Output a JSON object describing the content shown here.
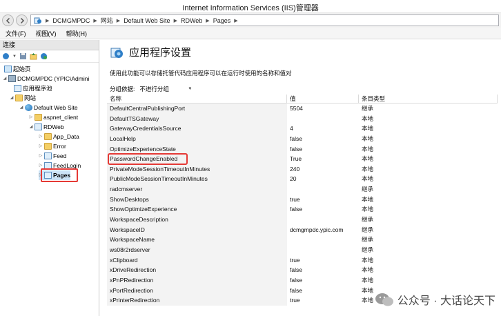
{
  "window": {
    "title": "Internet Information Services (IIS)管理器"
  },
  "address": {
    "segments": [
      "DCMGMPDC",
      "网站",
      "Default Web Site",
      "RDWeb",
      "Pages"
    ]
  },
  "menu": {
    "items": [
      "文件(F)",
      "视图(V)",
      "帮助(H)"
    ]
  },
  "connections": {
    "title": "连接",
    "tree": [
      {
        "label": "起始页",
        "icon": "start-page-icon"
      },
      {
        "label": "DCMGMPDC (YPIC\\Admini",
        "icon": "server-icon"
      },
      {
        "label": "应用程序池",
        "icon": "app-pool-icon"
      },
      {
        "label": "网站",
        "icon": "sites-folder-icon"
      },
      {
        "label": "Default Web Site",
        "icon": "globe-icon"
      },
      {
        "label": "aspnet_client",
        "icon": "folder-icon"
      },
      {
        "label": "RDWeb",
        "icon": "application-icon"
      },
      {
        "label": "App_Data",
        "icon": "folder-icon"
      },
      {
        "label": "Error",
        "icon": "folder-icon"
      },
      {
        "label": "Feed",
        "icon": "application-icon"
      },
      {
        "label": "FeedLogin",
        "icon": "application-icon"
      },
      {
        "label": "Pages",
        "icon": "application-icon"
      }
    ]
  },
  "main": {
    "heading": "应用程序设置",
    "description": "使用此功能可以存储托管代码应用程序可以在运行时使用的名称和值对",
    "group_by_label": "分组依据:",
    "group_by_value": "不进行分组",
    "columns": [
      "名称",
      "值",
      "条目类型"
    ],
    "rows": [
      {
        "name": "DefaultCentralPublishingPort",
        "value": "5504",
        "type": "继承"
      },
      {
        "name": "DefaultTSGateway",
        "value": "",
        "type": "本地"
      },
      {
        "name": "GatewayCredentialsSource",
        "value": "4",
        "type": "本地"
      },
      {
        "name": "LocalHelp",
        "value": "false",
        "type": "本地"
      },
      {
        "name": "OptimizeExperienceState",
        "value": "false",
        "type": "本地"
      },
      {
        "name": "PasswordChangeEnabled",
        "value": "True",
        "type": "本地"
      },
      {
        "name": "PrivateModeSessionTimeoutInMinutes",
        "value": "240",
        "type": "本地"
      },
      {
        "name": "PublicModeSessionTimeoutInMinutes",
        "value": "20",
        "type": "本地"
      },
      {
        "name": "radcmserver",
        "value": "",
        "type": "继承"
      },
      {
        "name": "ShowDesktops",
        "value": "true",
        "type": "本地"
      },
      {
        "name": "ShowOptimizeExperience",
        "value": "false",
        "type": "本地"
      },
      {
        "name": "WorkspaceDescription",
        "value": "",
        "type": "继承"
      },
      {
        "name": "WorkspaceID",
        "value": "dcmgmpdc.ypic.com",
        "type": "继承"
      },
      {
        "name": "WorkspaceName",
        "value": "",
        "type": "继承"
      },
      {
        "name": "ws08r2rdserver",
        "value": "",
        "type": "继承"
      },
      {
        "name": "xClipboard",
        "value": "true",
        "type": "本地"
      },
      {
        "name": "xDriveRedirection",
        "value": "false",
        "type": "本地"
      },
      {
        "name": "xPnPRedirection",
        "value": "false",
        "type": "本地"
      },
      {
        "name": "xPortRedirection",
        "value": "false",
        "type": "本地"
      },
      {
        "name": "xPrinterRedirection",
        "value": "true",
        "type": "本地"
      }
    ]
  },
  "watermark": {
    "text": "公众号 · 大话论天下"
  },
  "colors": {
    "highlight": "#e53935"
  }
}
